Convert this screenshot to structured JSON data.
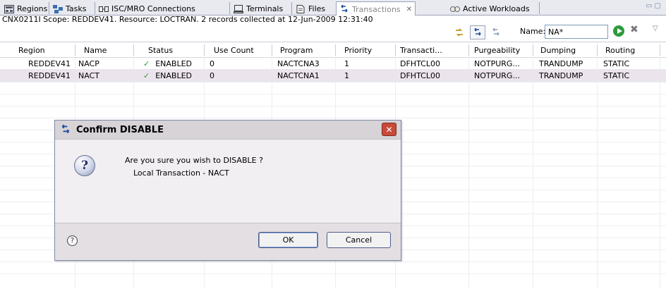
{
  "tabs": [
    {
      "label": "Regions",
      "icon": "regions-icon"
    },
    {
      "label": "Tasks",
      "icon": "tasks-icon"
    },
    {
      "label": "ISC/MRO Connections",
      "icon": "connections-icon"
    },
    {
      "label": "Terminals",
      "icon": "terminal-icon"
    },
    {
      "label": "Files",
      "icon": "files-icon"
    },
    {
      "label": "Transactions",
      "icon": "transactions-icon",
      "close": "✕"
    },
    {
      "label": "Active Workloads",
      "icon": "workloads-icon"
    }
  ],
  "toolbar": {
    "status_message": "CNX0211I Scope: REDDEV41. Resource: LOCTRAN. 2 records collected at 12-Jun-2009 12:31:40",
    "name_label": "Name:",
    "name_value": "NA*"
  },
  "table": {
    "columns": [
      "Region",
      "Name",
      "Status",
      "Use Count",
      "Program",
      "Priority",
      "Transacti...",
      "Purgeability",
      "Dumping",
      "Routing"
    ],
    "rows": [
      {
        "region": "REDDEV41",
        "name": "NACP",
        "status": "ENABLED",
        "use_count": "0",
        "program": "NACTCNA3",
        "priority": "1",
        "transaction": "DFHTCL00",
        "purgeability": "NOTPURG...",
        "dumping": "TRANDUMP",
        "routing": "STATIC"
      },
      {
        "region": "REDDEV41",
        "name": "NACT",
        "status": "ENABLED",
        "use_count": "0",
        "program": "NACTCNA1",
        "priority": "1",
        "transaction": "DFHTCL00",
        "purgeability": "NOTPURG...",
        "dumping": "TRANDUMP",
        "routing": "STATIC"
      }
    ]
  },
  "dialog": {
    "title": "Confirm DISABLE",
    "close_glyph": "✕",
    "message": "Are you sure you wish to DISABLE ?",
    "detail": "Local Transaction - NACT",
    "help_glyph": "?",
    "question_glyph": "?",
    "ok_label": "OK",
    "cancel_label": "Cancel"
  },
  "colors": {
    "selected_row": "#ece4ec",
    "enabled_check": "#2e9a3c",
    "dialog_close": "#c94a3a"
  }
}
